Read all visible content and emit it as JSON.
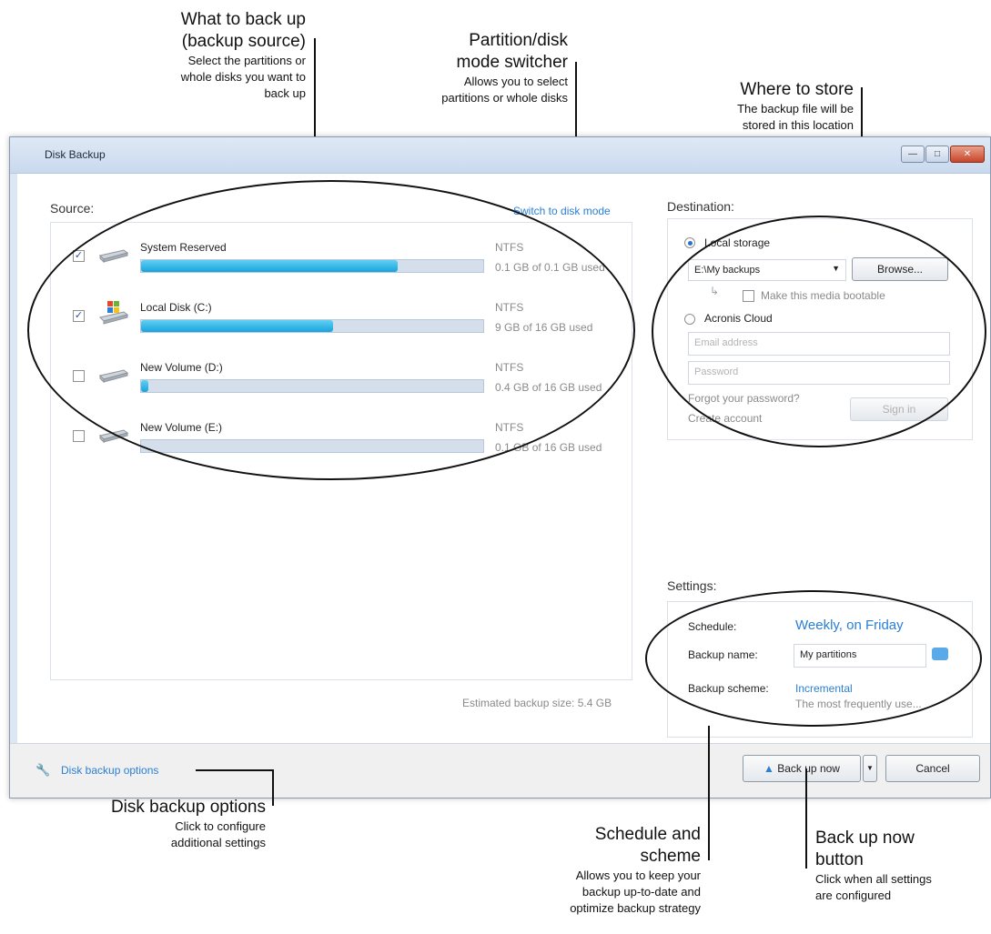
{
  "callouts": {
    "source": {
      "title_line1": "What to back up",
      "title_line2": "(backup source)",
      "desc_line1": "Select the partitions or",
      "desc_line2": "whole disks you want to",
      "desc_line3": "back up"
    },
    "switcher": {
      "title_line1": "Partition/disk",
      "title_line2": "mode switcher",
      "desc_line1": "Allows you to select",
      "desc_line2": "partitions or whole disks"
    },
    "store": {
      "title": "Where to store",
      "desc_line1": "The backup file will be",
      "desc_line2": "stored in this location"
    },
    "options": {
      "title": "Disk backup options",
      "desc_line1": "Click to configure",
      "desc_line2": "additional settings"
    },
    "schedule": {
      "title_line1": "Schedule and",
      "title_line2": "scheme",
      "desc_line1": "Allows you to keep your",
      "desc_line2": "backup up-to-date and",
      "desc_line3": "optimize backup strategy"
    },
    "backup_now": {
      "title_line1": "Back up now",
      "title_line2": "button",
      "desc_line1": "Click when all settings",
      "desc_line2": "are configured"
    }
  },
  "window": {
    "title": "Disk Backup",
    "minimize_icon": "minimize-icon",
    "maximize_icon": "maximize-icon",
    "close_icon": "close-icon"
  },
  "source": {
    "label": "Source:",
    "switch_link": "Switch to disk mode",
    "volumes": [
      {
        "name": "System Reserved",
        "fs": "NTFS",
        "usage": "0.1 GB of 0.1 GB used",
        "checked": true,
        "fill": 0.75,
        "icon": "hard-drive-icon"
      },
      {
        "name": "Local Disk (C:)",
        "fs": "NTFS",
        "usage": "9 GB of 16 GB used",
        "checked": true,
        "fill": 0.56,
        "icon": "windows-drive-icon"
      },
      {
        "name": "New Volume (D:)",
        "fs": "NTFS",
        "usage": "0.4 GB of 16 GB used",
        "checked": false,
        "fill": 0.02,
        "icon": "hard-drive-icon"
      },
      {
        "name": "New Volume (E:)",
        "fs": "NTFS",
        "usage": "0.1 GB of 16 GB used",
        "checked": false,
        "fill": 0.0,
        "icon": "hard-drive-icon"
      }
    ],
    "estimated": "Estimated backup size: 5.4 GB"
  },
  "destination": {
    "label": "Destination:",
    "local_storage": "Local storage",
    "path_value": "E:\\My backups",
    "browse": "Browse...",
    "bootable": "Make this media bootable",
    "cloud": "Acronis Cloud",
    "email_placeholder": "Email address",
    "password_placeholder": "Password",
    "forgot": "Forgot your password?",
    "create": "Create account",
    "sign_in": "Sign in"
  },
  "settings": {
    "label": "Settings:",
    "schedule_label": "Schedule:",
    "schedule_value": "Weekly, on Friday",
    "backup_name_label": "Backup name:",
    "backup_name_value": "My partitions",
    "scheme_label": "Backup scheme:",
    "scheme_value": "Incremental",
    "scheme_desc": "The most frequently use..."
  },
  "footer": {
    "options_link": "Disk backup options",
    "backup_now": "Back up now",
    "cancel": "Cancel"
  },
  "colors": {
    "link": "#2a7fd4",
    "progress": "#1aa3dc"
  }
}
